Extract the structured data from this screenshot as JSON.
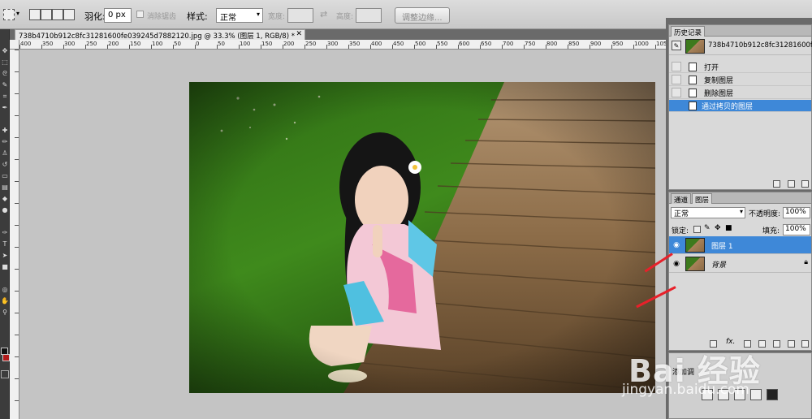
{
  "options_bar": {
    "feather_label": "羽化:",
    "feather_value": "0 px",
    "antialias_label": "消除锯齿",
    "style_label": "样式:",
    "style_value": "正常",
    "width_label": "宽度:",
    "height_label": "高度:",
    "refine_edge_button": "调整边缘..."
  },
  "document": {
    "tab_title": "738b4710b912c8fc31281600fe039245d7882120.jpg @ 33.3% (图层 1, RGB/8) *",
    "tab_close": "✕"
  },
  "ruler": {
    "h_ticks": [
      "400",
      "350",
      "300",
      "250",
      "200",
      "150",
      "100",
      "50",
      "0",
      "50",
      "100",
      "150",
      "200",
      "250",
      "300",
      "350",
      "400",
      "450",
      "500",
      "550",
      "600",
      "650",
      "700",
      "750",
      "800",
      "850",
      "900",
      "950",
      "1000",
      "1050"
    ]
  },
  "history_panel": {
    "tab_label": "历史记录",
    "snapshot_label": "738b4710b912c8fc31281600fe03...",
    "items": [
      {
        "label": "打开"
      },
      {
        "label": "复制图层"
      },
      {
        "label": "删除图层"
      },
      {
        "label": "通过拷贝的图层"
      }
    ]
  },
  "layers_panel": {
    "tabs": [
      "通道",
      "图层"
    ],
    "blend_mode": "正常",
    "opacity_label": "不透明度:",
    "opacity_value": "100%",
    "lock_label": "锁定:",
    "fill_label": "填充:",
    "fill_value": "100%",
    "layers": [
      {
        "name": "图层 1",
        "selected": true
      },
      {
        "name": "背景",
        "selected": false
      }
    ]
  },
  "bottom_panel": {
    "label": "添加调"
  },
  "watermark": {
    "logo": "Bai 经验",
    "url": "jingyan.baidu.com"
  },
  "colors": {
    "selection_blue": "#3e88d8",
    "arrow_red": "#e8202a"
  }
}
